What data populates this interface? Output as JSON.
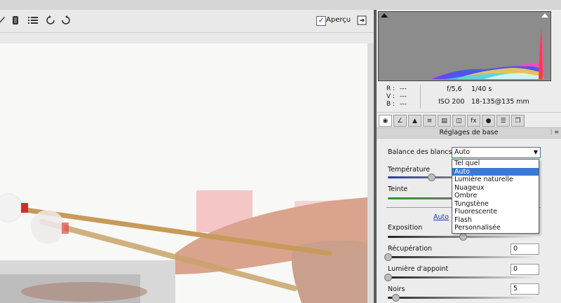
{
  "toolbar": {
    "icons": [
      "brush-icon",
      "eraser-icon",
      "list-icon",
      "rotate-left-icon",
      "rotate-right-icon"
    ],
    "preview_checked": "✓",
    "preview_label": "Aperçu"
  },
  "info": {
    "r_label": "R :",
    "r_value": "---",
    "g_label": "V :",
    "g_value": "---",
    "b_label": "B :",
    "b_value": "---",
    "aperture": "f/5,6",
    "shutter": "1/40 s",
    "iso": "ISO 200",
    "lens": "18-135@135 mm"
  },
  "tabs": [
    "basic-icon",
    "tone-curve-icon",
    "detail-icon",
    "hsl-icon",
    "split-toning-icon",
    "lens-corrections-icon",
    "effects-icon",
    "camera-calibration-icon",
    "presets-icon",
    "snapshots-icon"
  ],
  "panel": {
    "title": "Réglages de base",
    "white_balance_label": "Balance des blancs :",
    "white_balance_value": "Auto",
    "temperature_label": "Température",
    "tint_label": "Teinte",
    "auto_link": "Auto",
    "exposure_label": "Exposition",
    "recovery_label": "Récupération",
    "recovery_value": "0",
    "fill_light_label": "Lumière d'appoint",
    "fill_light_value": "0",
    "blacks_label": "Noirs",
    "blacks_value": "5",
    "slider_levels": {
      "temperature": 0.29,
      "tint": 0.5,
      "exposure": 0.5,
      "recovery": 0.0,
      "fill_light": 0.0,
      "blacks": 0.05
    }
  },
  "dropdown": {
    "options": [
      "Tel quel",
      "Auto",
      "Lumière naturelle",
      "Nuageux",
      "Ombre",
      "Tungstène",
      "Fluorescente",
      "Flash",
      "Personnalisée"
    ],
    "selected": "Auto"
  },
  "colors": {
    "accent": "#3a78d6",
    "link": "#1b3fa8",
    "histogram_bg": "#8c8c8c"
  }
}
